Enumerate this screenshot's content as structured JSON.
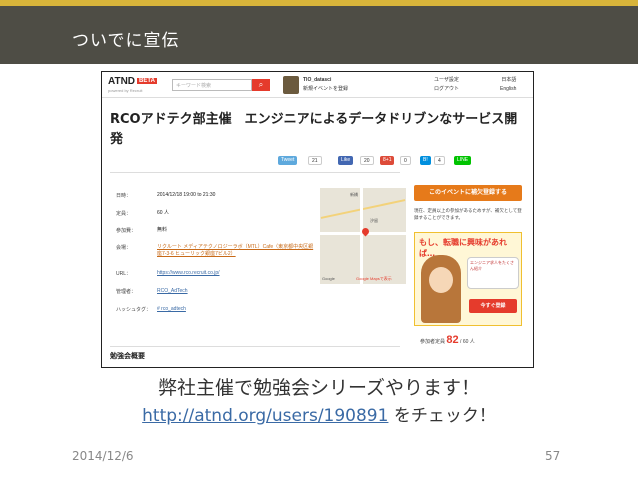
{
  "slide": {
    "title": "ついでに宣伝",
    "caption_line1": "弊社主催で勉強会シリーズやります！",
    "caption_link": "http://atnd.org/users/190891",
    "caption_suffix": " をチェック！",
    "date": "2014/12/6",
    "page_number": "57"
  },
  "atnd": {
    "logo": "ATND",
    "beta": "BETA",
    "powered": "powered by Recruit",
    "search_placeholder": "キーワード検索",
    "search_icon": "search-icon",
    "user_name": "TIO_datasci",
    "user_action": "新規イベントを登録",
    "menu1": "ユーザ設定",
    "menu2": "ログアウト",
    "lang_ja": "日本語",
    "lang_en": "English",
    "event_title": "RCOアドテク部主催　エンジニアによるデータドリブンなサービス開発",
    "share": {
      "tweet": "Tweet",
      "tweet_count": "21",
      "like": "Like",
      "like_count": "20",
      "gplus": "8+1",
      "gplus_count": "0",
      "hatena_count": "4",
      "line": "LINEで送る"
    },
    "info": {
      "date_label": "日時：",
      "date_value": "2014/12/18 19:00 to 21:30",
      "capacity_label": "定員：",
      "capacity_value": "60 人",
      "fee_label": "参加費：",
      "fee_value": "無料",
      "venue_label": "会場：",
      "venue_value": "リクルート メディアテクノロジーラボ（MTL）Cafe（東京都中央区銀座7-3-6 ヒューリック銀座7ビル2）",
      "url_label": "URL：",
      "url_value": "https://www.rco.recruit.co.jp/",
      "admin_label": "管理者：",
      "admin_value": "RCO_AdTech",
      "hashtag_label": "ハッシュタグ：",
      "hashtag_value": "# rco_adtech"
    },
    "map_labels": [
      "新橋",
      "汐留",
      "Google",
      "Google Mapsで表示"
    ],
    "register_button": "このイベントに補欠登録する",
    "side_note": "現在、定員以上の参加があるためすが、補欠として登録することができます。",
    "ad_title": "もし、転職に興味があれば…",
    "ad_bubble": "エンジニア求人をたくさん紹介",
    "ad_cta": "今すぐ登録",
    "count_label": "参加者定員",
    "count_value": "82",
    "count_cap": "/ 60 人",
    "section_title": "勉強会概要"
  }
}
